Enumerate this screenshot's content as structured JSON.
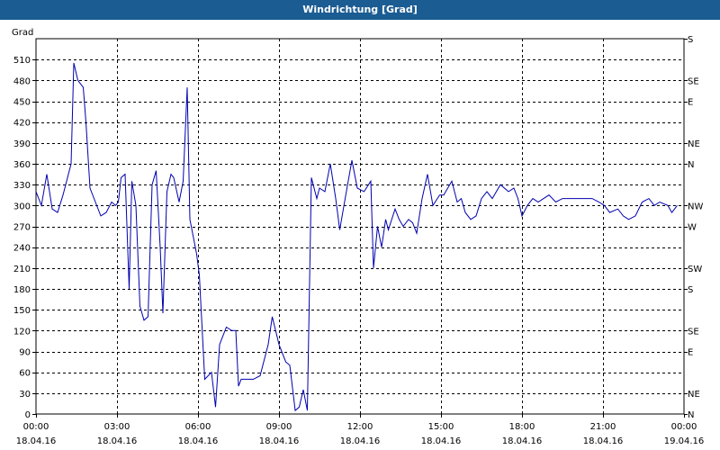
{
  "window": {
    "title": "Windrichtung [Grad]"
  },
  "chart_data": {
    "type": "line",
    "title": "Windrichtung [Grad]",
    "ylabel": "Grad",
    "ylim": [
      0,
      540
    ],
    "y_ticks": [
      0,
      30,
      60,
      90,
      120,
      150,
      180,
      210,
      240,
      270,
      300,
      330,
      360,
      390,
      420,
      450,
      480,
      510
    ],
    "right_axis_labels": [
      "N",
      "NE",
      "E",
      "SE",
      "S",
      "SW",
      "W",
      "NW",
      "N",
      "NE",
      "E",
      "SE",
      "S"
    ],
    "right_axis_values": [
      0,
      30,
      90,
      120,
      180,
      210,
      270,
      300,
      360,
      390,
      450,
      480,
      540
    ],
    "xlim": [
      0,
      24
    ],
    "x_ticks": [
      {
        "time": "00:00",
        "date": "18.04.16",
        "hour": 0
      },
      {
        "time": "03:00",
        "date": "18.04.16",
        "hour": 3
      },
      {
        "time": "06:00",
        "date": "18.04.16",
        "hour": 6
      },
      {
        "time": "09:00",
        "date": "18.04.16",
        "hour": 9
      },
      {
        "time": "12:00",
        "date": "18.04.16",
        "hour": 12
      },
      {
        "time": "15:00",
        "date": "18.04.16",
        "hour": 15
      },
      {
        "time": "18:00",
        "date": "18.04.16",
        "hour": 18
      },
      {
        "time": "21:00",
        "date": "18.04.16",
        "hour": 21
      },
      {
        "time": "00:00",
        "date": "19.04.16",
        "hour": 24
      }
    ],
    "grid": true,
    "colors": {
      "line": "#0000b0",
      "grid": "#000000",
      "title_bar": "#1b5c93"
    },
    "series": [
      {
        "x": [
          0,
          0.2,
          0.4,
          0.6,
          0.8,
          1.0,
          1.3,
          1.4,
          1.55,
          1.75,
          1.85,
          2.0,
          2.2,
          2.4,
          2.6,
          2.8,
          2.95,
          3.05,
          3.15,
          3.3,
          3.45,
          3.55,
          3.7,
          3.85,
          4.0,
          4.15,
          4.3,
          4.45,
          4.6,
          4.7,
          4.85,
          5.0,
          5.1,
          5.3,
          5.45,
          5.6,
          5.7,
          5.8,
          5.95,
          6.05,
          6.25,
          6.5,
          6.65,
          6.8,
          7.05,
          7.25,
          7.4,
          7.5,
          7.6,
          7.7,
          8.05,
          8.3,
          8.6,
          8.75,
          9.0,
          9.25,
          9.4,
          9.6,
          9.75,
          9.9,
          10.05,
          10.2,
          10.4,
          10.5,
          10.7,
          10.9,
          11.1,
          11.25,
          11.45,
          11.7,
          11.9,
          12.15,
          12.4,
          12.5,
          12.65,
          12.8,
          12.95,
          13.05,
          13.3,
          13.45,
          13.6,
          13.8,
          13.95,
          14.1,
          14.3,
          14.5,
          14.7,
          14.95,
          15.1,
          15.4,
          15.6,
          15.75,
          15.9,
          16.1,
          16.3,
          16.5,
          16.7,
          16.9,
          17.2,
          17.5,
          17.7,
          17.85,
          18.0,
          18.2,
          18.4,
          18.6,
          18.8,
          19.0,
          19.25,
          19.5,
          19.75,
          20.0,
          20.3,
          20.6,
          20.85,
          21.05,
          21.25,
          21.55,
          21.75,
          21.95,
          22.2,
          22.45,
          22.7,
          22.9,
          23.1,
          23.4,
          23.55,
          23.75
        ],
        "values": [
          320,
          300,
          345,
          295,
          290,
          315,
          360,
          505,
          480,
          470,
          420,
          325,
          305,
          285,
          290,
          305,
          300,
          305,
          340,
          345,
          180,
          335,
          300,
          155,
          135,
          140,
          330,
          350,
          240,
          145,
          320,
          345,
          340,
          305,
          335,
          470,
          280,
          260,
          230,
          200,
          50,
          60,
          10,
          100,
          125,
          120,
          120,
          40,
          50,
          50,
          50,
          55,
          100,
          140,
          100,
          75,
          70,
          5,
          10,
          35,
          5,
          340,
          310,
          325,
          320,
          360,
          310,
          265,
          310,
          365,
          325,
          320,
          335,
          210,
          270,
          240,
          280,
          265,
          295,
          280,
          270,
          280,
          275,
          260,
          310,
          345,
          300,
          315,
          315,
          335,
          305,
          310,
          290,
          280,
          285,
          310,
          320,
          310,
          330,
          320,
          325,
          310,
          285,
          300,
          310,
          305,
          310,
          315,
          305,
          310,
          310,
          310,
          310,
          310,
          305,
          300,
          290,
          295,
          285,
          280,
          285,
          305,
          310,
          300,
          305,
          300,
          290,
          300
        ]
      }
    ]
  }
}
